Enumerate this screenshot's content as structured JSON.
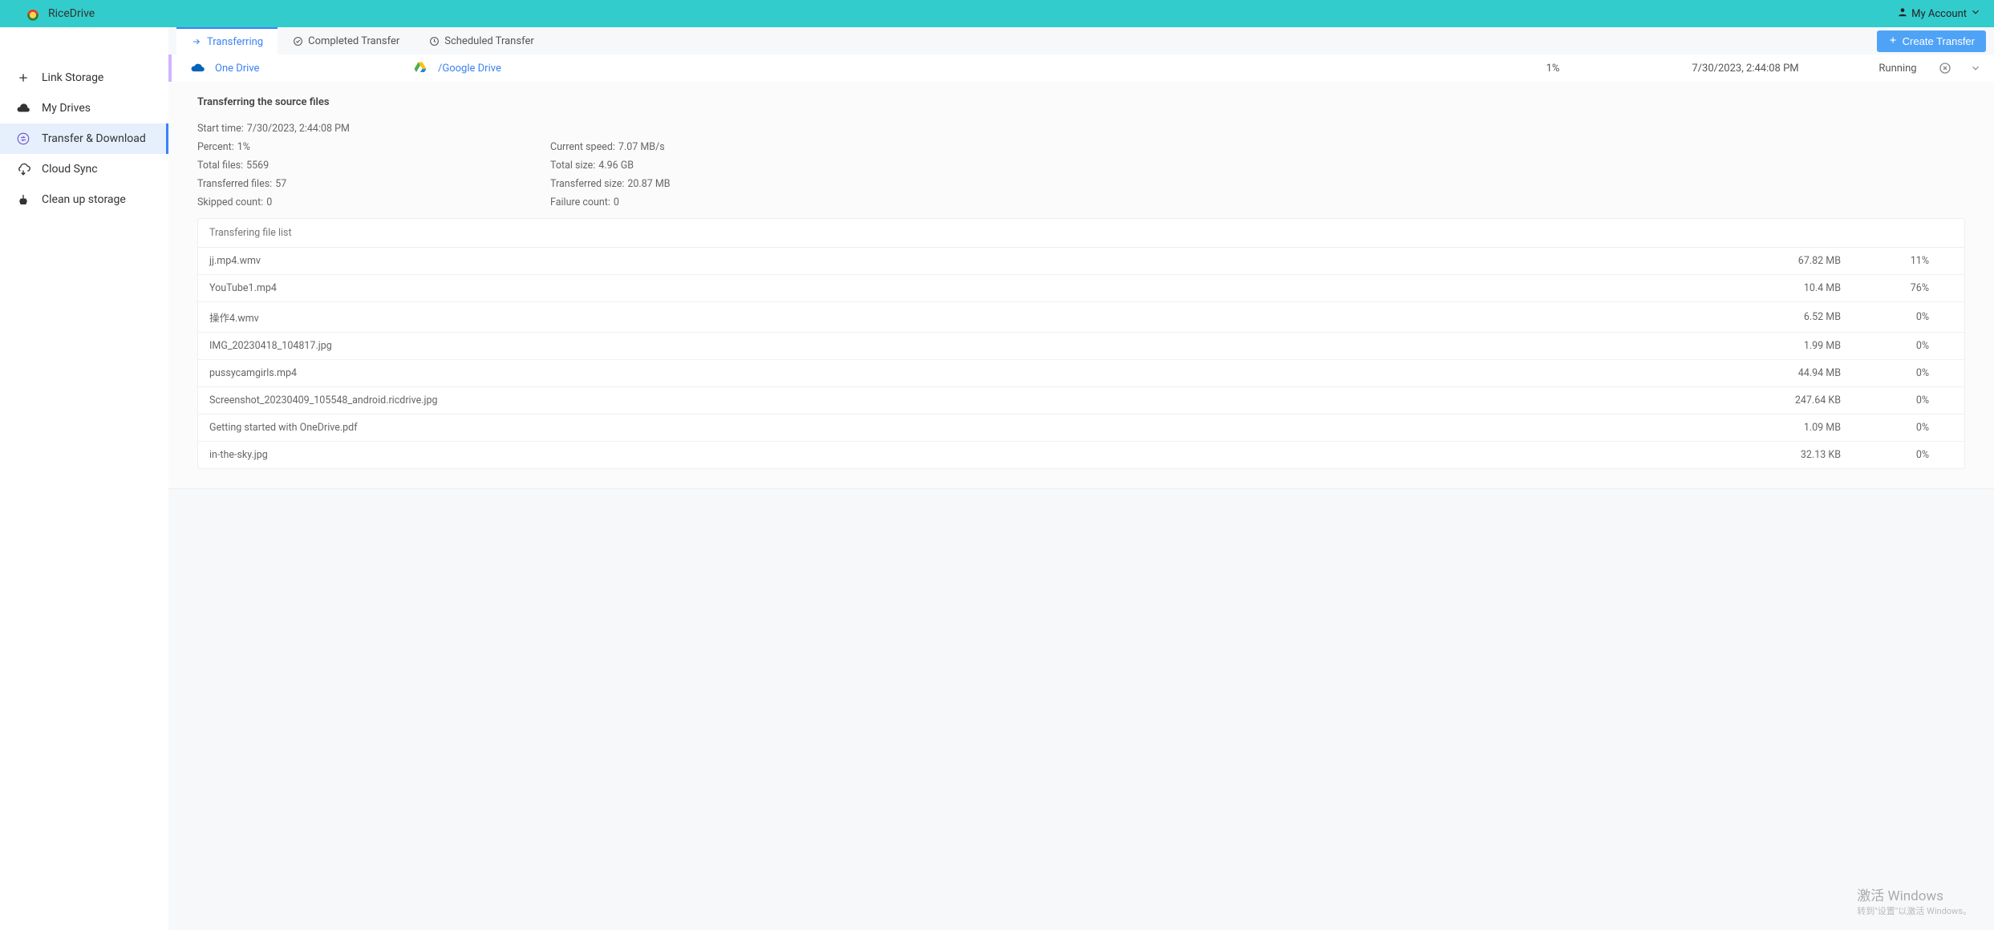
{
  "brand": {
    "name": "RiceDrive"
  },
  "account": {
    "label": "My Account"
  },
  "sidebar": {
    "items": [
      {
        "label": "Link Storage"
      },
      {
        "label": "My Drives"
      },
      {
        "label": "Transfer & Download"
      },
      {
        "label": "Cloud Sync"
      },
      {
        "label": "Clean up storage"
      }
    ]
  },
  "tabs": {
    "transferring": "Transferring",
    "completed": "Completed Transfer",
    "scheduled": "Scheduled Transfer"
  },
  "create_button": "Create Transfer",
  "job": {
    "source_label": "One Drive",
    "dest_label": "/Google Drive",
    "percent": "1%",
    "timestamp": "7/30/2023, 2:44:08 PM",
    "status": "Running"
  },
  "details": {
    "title": "Transferring the source files",
    "labels": {
      "start_time": "Start time:",
      "percent": "Percent:",
      "speed": "Current speed:",
      "total_files": "Total files:",
      "total_size": "Total size:",
      "transferred_files": "Transferred files:",
      "transferred_size": "Transferred size:",
      "skipped": "Skipped count:",
      "failure": "Failure count:"
    },
    "values": {
      "start_time": "7/30/2023, 2:44:08 PM",
      "percent": "1%",
      "speed": "7.07 MB/s",
      "total_files": "5569",
      "total_size": "4.96 GB",
      "transferred_files": "57",
      "transferred_size": "20.87 MB",
      "skipped": "0",
      "failure": "0"
    }
  },
  "filelist": {
    "header": "Transfering file list",
    "rows": [
      {
        "name": "jj.mp4.wmv",
        "size": "67.82 MB",
        "pct": "11%"
      },
      {
        "name": "YouTube1.mp4",
        "size": "10.4 MB",
        "pct": "76%"
      },
      {
        "name": "操作4.wmv",
        "size": "6.52 MB",
        "pct": "0%"
      },
      {
        "name": "IMG_20230418_104817.jpg",
        "size": "1.99 MB",
        "pct": "0%"
      },
      {
        "name": "pussycamgirls.mp4",
        "size": "44.94 MB",
        "pct": "0%"
      },
      {
        "name": "Screenshot_20230409_105548_android.ricdrive.jpg",
        "size": "247.64 KB",
        "pct": "0%"
      },
      {
        "name": "Getting started with OneDrive.pdf",
        "size": "1.09 MB",
        "pct": "0%"
      },
      {
        "name": "in-the-sky.jpg",
        "size": "32.13 KB",
        "pct": "0%"
      }
    ]
  },
  "watermark": {
    "line1": "激活 Windows",
    "line2": "转到\"设置\"以激活 Windows。"
  }
}
